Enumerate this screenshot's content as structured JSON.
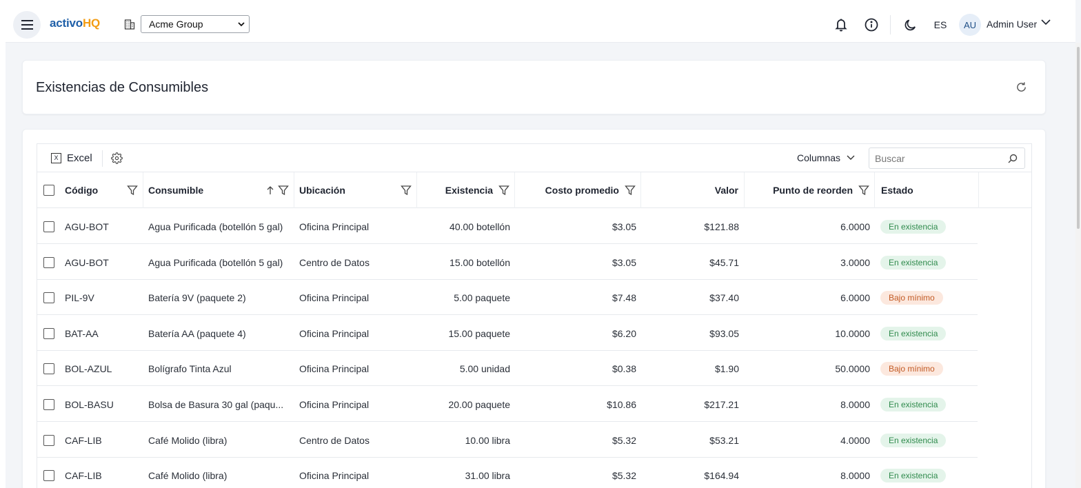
{
  "header": {
    "logo_part1": "activo",
    "logo_part2": "HQ",
    "company_selected": "Acme Group",
    "language": "ES",
    "avatar_initials": "AU",
    "user_name": "Admin User"
  },
  "page": {
    "title": "Existencias de Consumibles"
  },
  "toolbar": {
    "excel_label": "Excel",
    "excel_icon_letter": "X",
    "columns_label": "Columnas",
    "search_placeholder": "Buscar"
  },
  "table": {
    "columns": {
      "code": "Código",
      "consumable": "Consumible",
      "location": "Ubicación",
      "stock": "Existencia",
      "avg_cost": "Costo promedio",
      "value": "Valor",
      "reorder_point": "Punto de reorden",
      "status": "Estado"
    },
    "rows": [
      {
        "code": "AGU-BOT",
        "consumable": "Agua Purificada (botellón 5 gal)",
        "location": "Oficina Principal",
        "stock": "40.00 botellón",
        "avg_cost": "$3.05",
        "value": "$121.88",
        "reorder_point": "6.0000",
        "status": "En existencia",
        "status_type": "ok"
      },
      {
        "code": "AGU-BOT",
        "consumable": "Agua Purificada (botellón 5 gal)",
        "location": "Centro de Datos",
        "stock": "15.00 botellón",
        "avg_cost": "$3.05",
        "value": "$45.71",
        "reorder_point": "3.0000",
        "status": "En existencia",
        "status_type": "ok"
      },
      {
        "code": "PIL-9V",
        "consumable": "Batería 9V (paquete 2)",
        "location": "Oficina Principal",
        "stock": "5.00 paquete",
        "avg_cost": "$7.48",
        "value": "$37.40",
        "reorder_point": "6.0000",
        "status": "Bajo mínimo",
        "status_type": "low"
      },
      {
        "code": "BAT-AA",
        "consumable": "Batería AA (paquete 4)",
        "location": "Oficina Principal",
        "stock": "15.00 paquete",
        "avg_cost": "$6.20",
        "value": "$93.05",
        "reorder_point": "10.0000",
        "status": "En existencia",
        "status_type": "ok"
      },
      {
        "code": "BOL-AZUL",
        "consumable": "Bolígrafo Tinta Azul",
        "location": "Oficina Principal",
        "stock": "5.00 unidad",
        "avg_cost": "$0.38",
        "value": "$1.90",
        "reorder_point": "50.0000",
        "status": "Bajo mínimo",
        "status_type": "low"
      },
      {
        "code": "BOL-BASU",
        "consumable": "Bolsa de Basura 30 gal (paqu...",
        "location": "Oficina Principal",
        "stock": "20.00 paquete",
        "avg_cost": "$10.86",
        "value": "$217.21",
        "reorder_point": "8.0000",
        "status": "En existencia",
        "status_type": "ok"
      },
      {
        "code": "CAF-LIB",
        "consumable": "Café Molido (libra)",
        "location": "Centro de Datos",
        "stock": "10.00 libra",
        "avg_cost": "$5.32",
        "value": "$53.21",
        "reorder_point": "4.0000",
        "status": "En existencia",
        "status_type": "ok"
      },
      {
        "code": "CAF-LIB",
        "consumable": "Café Molido (libra)",
        "location": "Oficina Principal",
        "stock": "31.00 libra",
        "avg_cost": "$5.32",
        "value": "$164.94",
        "reorder_point": "8.0000",
        "status": "En existencia",
        "status_type": "ok"
      }
    ]
  },
  "colors": {
    "logo_blue": "#1f5fa8",
    "logo_orange": "#f39c12",
    "status_ok_bg": "#e4f4ea",
    "status_ok_text": "#2f8a4c",
    "status_low_bg": "#fce8de",
    "status_low_text": "#c25a24"
  },
  "icons": [
    "menu-icon",
    "building-icon",
    "bell-icon",
    "info-icon",
    "moon-icon",
    "chevron-down-icon",
    "refresh-icon",
    "excel-icon",
    "gear-icon",
    "search-icon",
    "filter-icon",
    "sort-up-icon"
  ]
}
